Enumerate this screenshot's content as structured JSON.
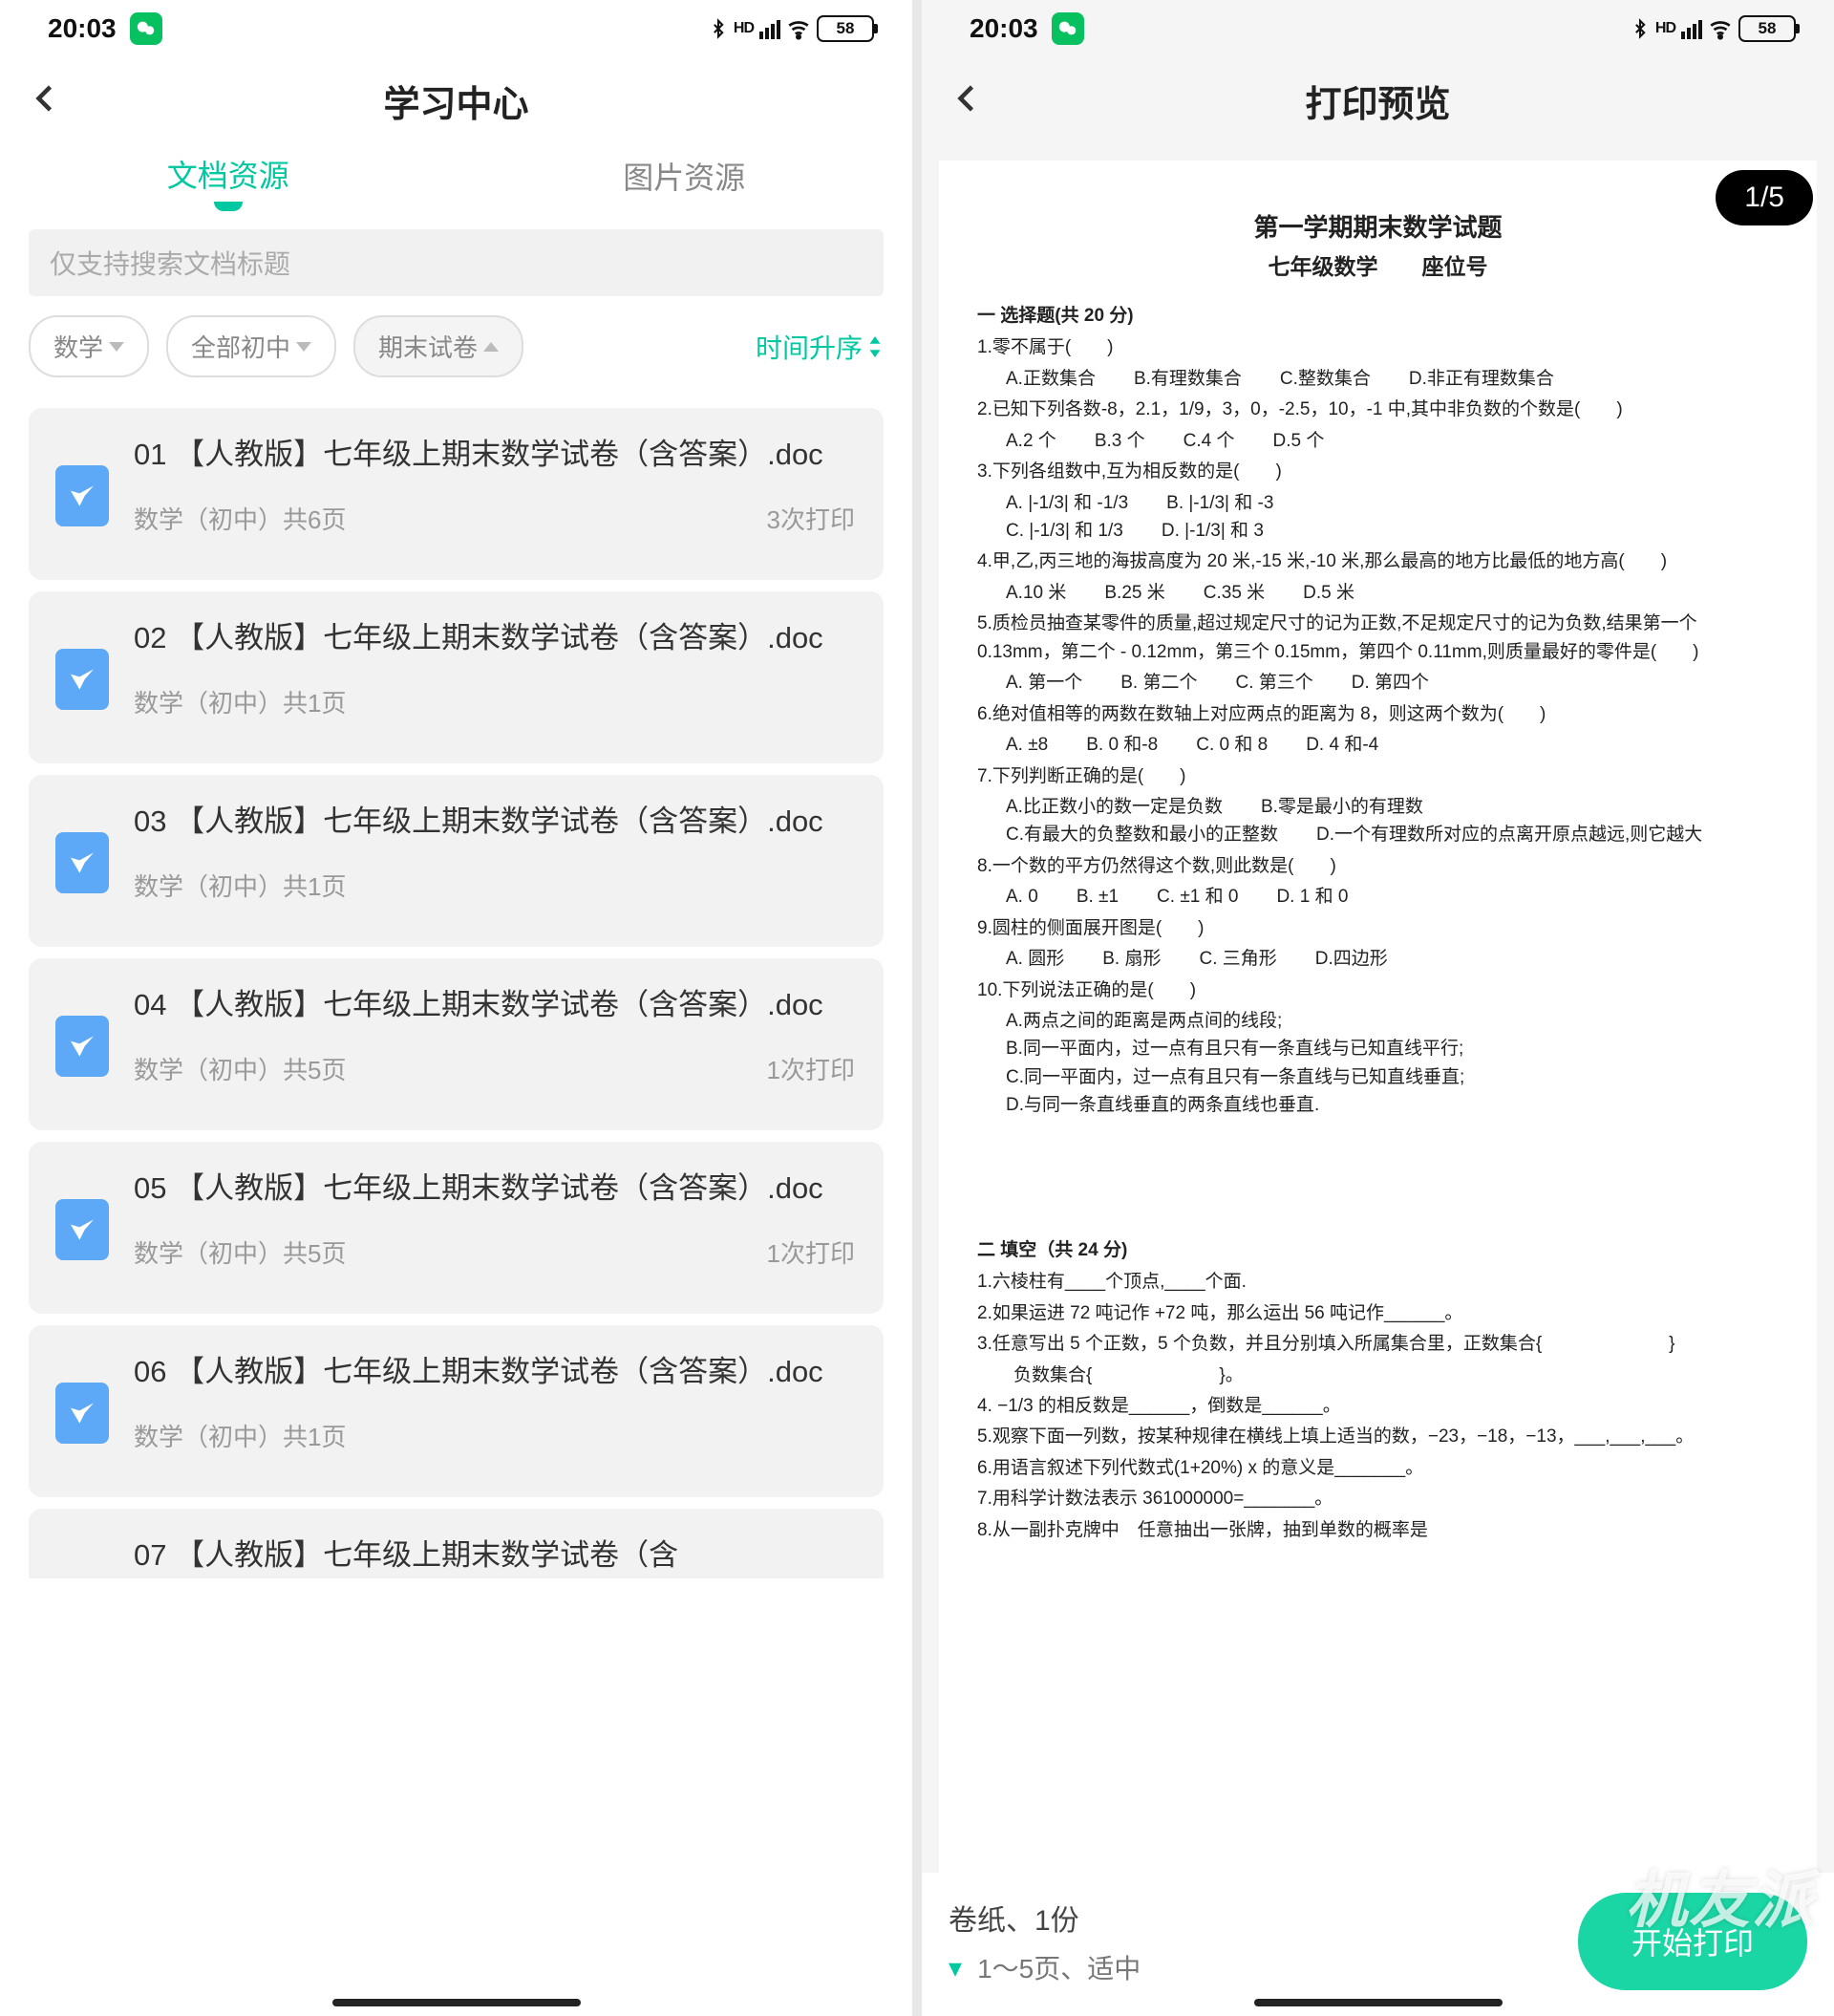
{
  "status": {
    "time": "20:03",
    "battery": "58"
  },
  "left": {
    "title": "学习中心",
    "tabs": {
      "active": "文档资源",
      "inactive": "图片资源"
    },
    "search_placeholder": "仅支持搜索文档标题",
    "filters": {
      "f1": "数学",
      "f2": "全部初中",
      "f3": "期末试卷"
    },
    "sort": "时间升序",
    "docs": [
      {
        "title": "01 【人教版】七年级上期末数学试卷（含答案）.doc",
        "meta": "数学（初中）共6页",
        "prints": "3次打印"
      },
      {
        "title": "02 【人教版】七年级上期末数学试卷（含答案）.doc",
        "meta": "数学（初中）共1页",
        "prints": ""
      },
      {
        "title": "03 【人教版】七年级上期末数学试卷（含答案）.doc",
        "meta": "数学（初中）共1页",
        "prints": ""
      },
      {
        "title": "04 【人教版】七年级上期末数学试卷（含答案）.doc",
        "meta": "数学（初中）共5页",
        "prints": "1次打印"
      },
      {
        "title": "05 【人教版】七年级上期末数学试卷（含答案）.doc",
        "meta": "数学（初中）共5页",
        "prints": "1次打印"
      },
      {
        "title": "06 【人教版】七年级上期末数学试卷（含答案）.doc",
        "meta": "数学（初中）共1页",
        "prints": ""
      },
      {
        "title": "07 【人教版】七年级上期末数学试卷（含",
        "meta": "",
        "prints": ""
      }
    ]
  },
  "right": {
    "title": "打印预览",
    "page_indicator": "1/5",
    "bottom": {
      "line1": "卷纸、1份",
      "line2": "1～5页、适中",
      "button": "开始打印"
    },
    "paper": {
      "title": "第一学期期末数学试题",
      "sub": "七年级数学　　座位号",
      "sec1": "一 选择题(共 20 分)",
      "q1": "1.零不属于(　　)",
      "q1o": [
        "A.正数集合",
        "B.有理数集合",
        "C.整数集合",
        "D.非正有理数集合"
      ],
      "q2": "2.已知下列各数-8，2.1，1/9，3，0，-2.5，10，-1 中,其中非负数的个数是(　　)",
      "q2o": [
        "A.2 个",
        "B.3 个",
        "C.4 个",
        "D.5 个"
      ],
      "q3": "3.下列各组数中,互为相反数的是(　　)",
      "q3o1": [
        "A. |-1/3| 和 -1/3",
        "B. |-1/3| 和 -3"
      ],
      "q3o2": [
        "C. |-1/3| 和 1/3",
        "D. |-1/3| 和 3"
      ],
      "q4": "4.甲,乙,丙三地的海拔高度为 20 米,-15 米,-10 米,那么最高的地方比最低的地方高(　　)",
      "q4o": [
        "A.10 米",
        "B.25 米",
        "C.35 米",
        "D.5 米"
      ],
      "q5": "5.质检员抽查某零件的质量,超过规定尺寸的记为正数,不足规定尺寸的记为负数,结果第一个 0.13mm，第二个 - 0.12mm，第三个 0.15mm，第四个 0.11mm,则质量最好的零件是(　　)",
      "q5o": [
        "A. 第一个",
        "B. 第二个",
        "C. 第三个",
        "D. 第四个"
      ],
      "q6": "6.绝对值相等的两数在数轴上对应两点的距离为 8，则这两个数为(　　)",
      "q6o": [
        "A. ±8",
        "B. 0 和-8",
        "C. 0 和 8",
        "D. 4 和-4"
      ],
      "q7": "7.下列判断正确的是(　　)",
      "q7o1": [
        "A.比正数小的数一定是负数",
        "B.零是最小的有理数"
      ],
      "q7o2": [
        "C.有最大的负整数和最小的正整数",
        "D.一个有理数所对应的点离开原点越远,则它越大"
      ],
      "q8": "8.一个数的平方仍然得这个数,则此数是(　　)",
      "q8o": [
        "A. 0",
        "B. ±1",
        "C. ±1 和 0",
        "D. 1 和 0"
      ],
      "q9": "9.圆柱的侧面展开图是(　　)",
      "q9o": [
        "A. 圆形",
        "B. 扇形",
        "C. 三角形",
        "D.四边形"
      ],
      "q10": "10.下列说法正确的是(　　)",
      "q10a": "A.两点之间的距离是两点间的线段;",
      "q10b": "B.同一平面内，过一点有且只有一条直线与已知直线平行;",
      "q10c": "C.同一平面内，过一点有且只有一条直线与已知直线垂直;",
      "q10d": "D.与同一条直线垂直的两条直线也垂直.",
      "sec2": "二 填空（共 24 分)",
      "f1": "1.六棱柱有____个顶点,____个面.",
      "f2": "2.如果运进 72 吨记作 +72 吨，那么运出 56 吨记作______。",
      "f3": "3.任意写出 5 个正数，5 个负数，并且分别填入所属集合里，正数集合{　　　　　　　}",
      "f3b": "　　负数集合{　　　　　　　}。",
      "f4": "4. −1/3 的相反数是______，倒数是______。",
      "f5": "5.观察下面一列数，按某种规律在横线上填上适当的数，−23，−18，−13，___,___,___。",
      "f6": "6.用语言叙述下列代数式(1+20%) x 的意义是_______。",
      "f7": "7.用科学计数法表示 361000000=_______。",
      "f8": "8.从一副扑克牌中　任意抽出一张牌，抽到单数的概率是"
    }
  },
  "watermark": "机友派"
}
